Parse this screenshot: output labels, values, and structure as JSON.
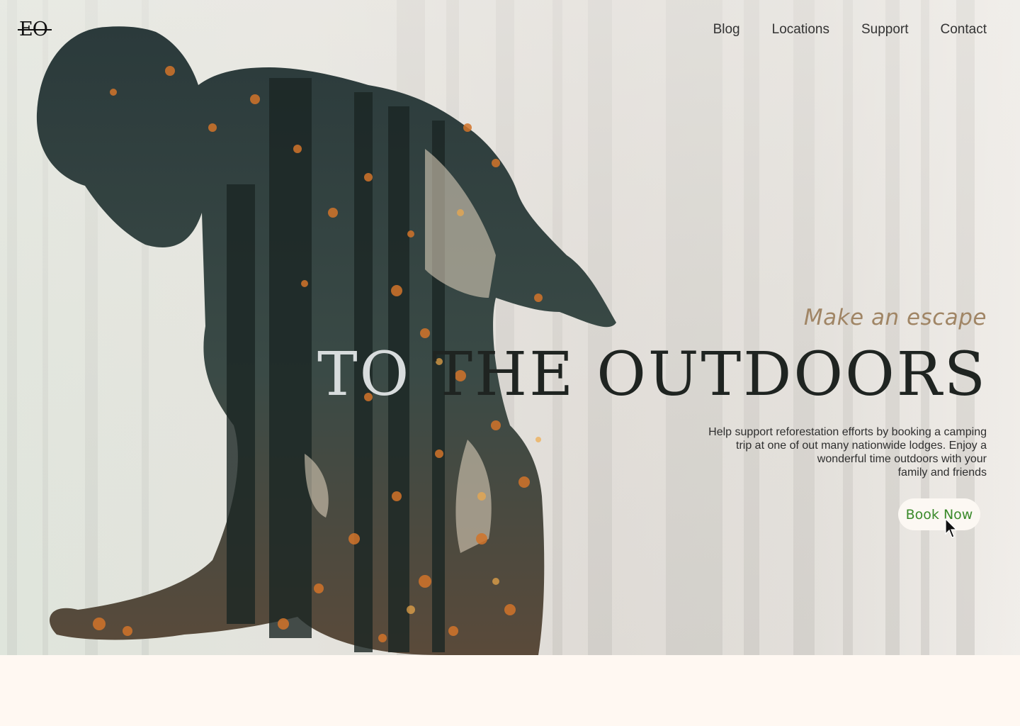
{
  "brand": {
    "logo_text": "EO"
  },
  "nav": {
    "items": [
      {
        "label": "Blog"
      },
      {
        "label": "Locations"
      },
      {
        "label": "Support"
      },
      {
        "label": "Contact"
      }
    ]
  },
  "hero": {
    "tagline": "Make an escape",
    "headline_light": "TO ",
    "headline_dark": "THE OUTDOORS",
    "description_lines": [
      "Help support reforestation efforts by booking a camping",
      "trip at one of out many nationwide lodges. Enjoy a",
      "wonderful time outdoors with your",
      "family and friends"
    ],
    "cta_label": "Book Now"
  },
  "colors": {
    "accent_tagline": "#a08565",
    "cta_text": "#3a8a2a",
    "page_background": "#fff8f2",
    "headline_dark": "#1f2421"
  },
  "icons": {
    "cursor": "arrow-cursor-icon"
  }
}
